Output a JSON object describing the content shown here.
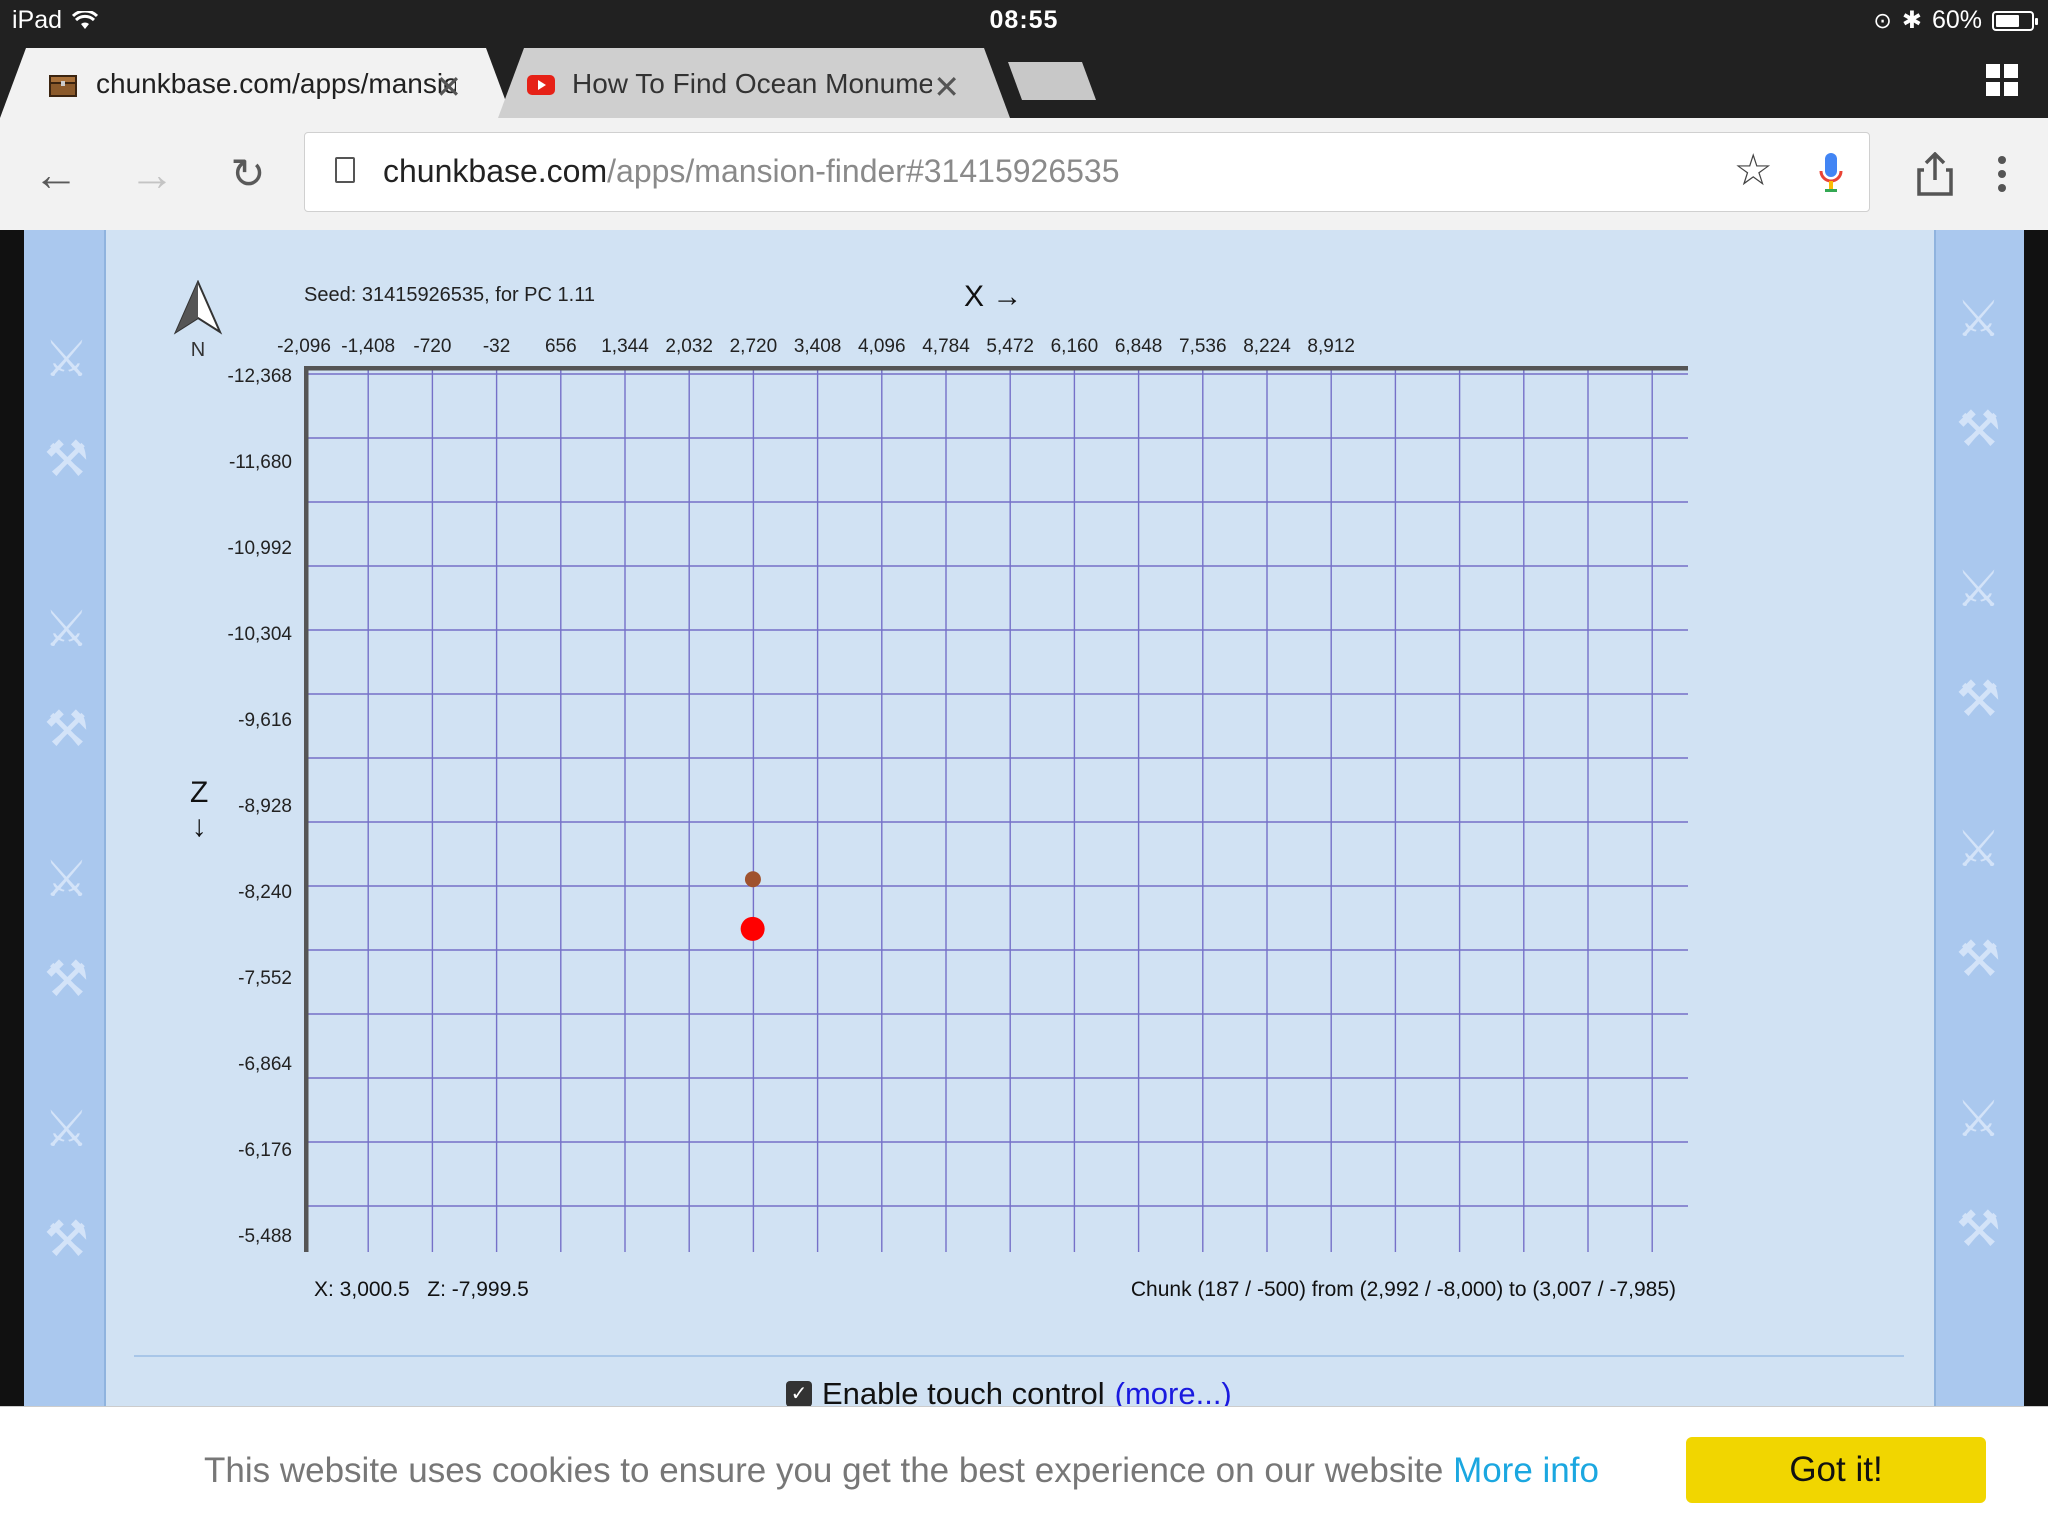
{
  "status_bar": {
    "device": "iPad",
    "time": "08:55",
    "battery": "60%"
  },
  "tabs": [
    {
      "title": "chunkbase.com/apps/mansion-finder",
      "favicon": "minecraft-chest-icon"
    },
    {
      "title": "How To Find Ocean Monuments",
      "favicon": "youtube-icon"
    }
  ],
  "address_bar": {
    "domain": "chunkbase.com",
    "path": "/apps/mansion-finder#31415926535"
  },
  "map": {
    "seed_label": "Seed: 31415926535, for PC 1.11",
    "compass_label": "N",
    "x_axis_title": "X →",
    "z_axis_title": "Z",
    "z_arrow": "↓",
    "x_ticks": [
      "-2,096",
      "-1,408",
      "-720",
      "-32",
      "656",
      "1,344",
      "2,032",
      "2,720",
      "3,408",
      "4,096",
      "4,784",
      "5,472",
      "6,160",
      "6,848",
      "7,536",
      "8,224",
      "8,912"
    ],
    "z_ticks": [
      "-12,368",
      "-11,680",
      "-10,992",
      "-10,304",
      "-9,616",
      "-8,928",
      "-8,240",
      "-7,552",
      "-6,864",
      "-6,176",
      "-5,488"
    ],
    "grid_color": "#7570c8",
    "markers": [
      {
        "name": "small-marker",
        "x": 2715,
        "z": -8326,
        "color": "#a0522d"
      },
      {
        "name": "mansion-marker",
        "x": 2712,
        "z": -7929,
        "color": "#ff0000"
      }
    ],
    "cursor_coords": "X: 3,000.5   Z: -7,999.5",
    "chunk_info": "Chunk (187 / -500) from (2,992 / -8,000) to (3,007 / -7,985)"
  },
  "touch_control": {
    "label": "Enable touch control",
    "more_link": "(more...)"
  },
  "cookie_banner": {
    "message": "This website uses cookies to ensure you get the best experience on our website",
    "more_info": "More info",
    "button": "Got it!"
  }
}
